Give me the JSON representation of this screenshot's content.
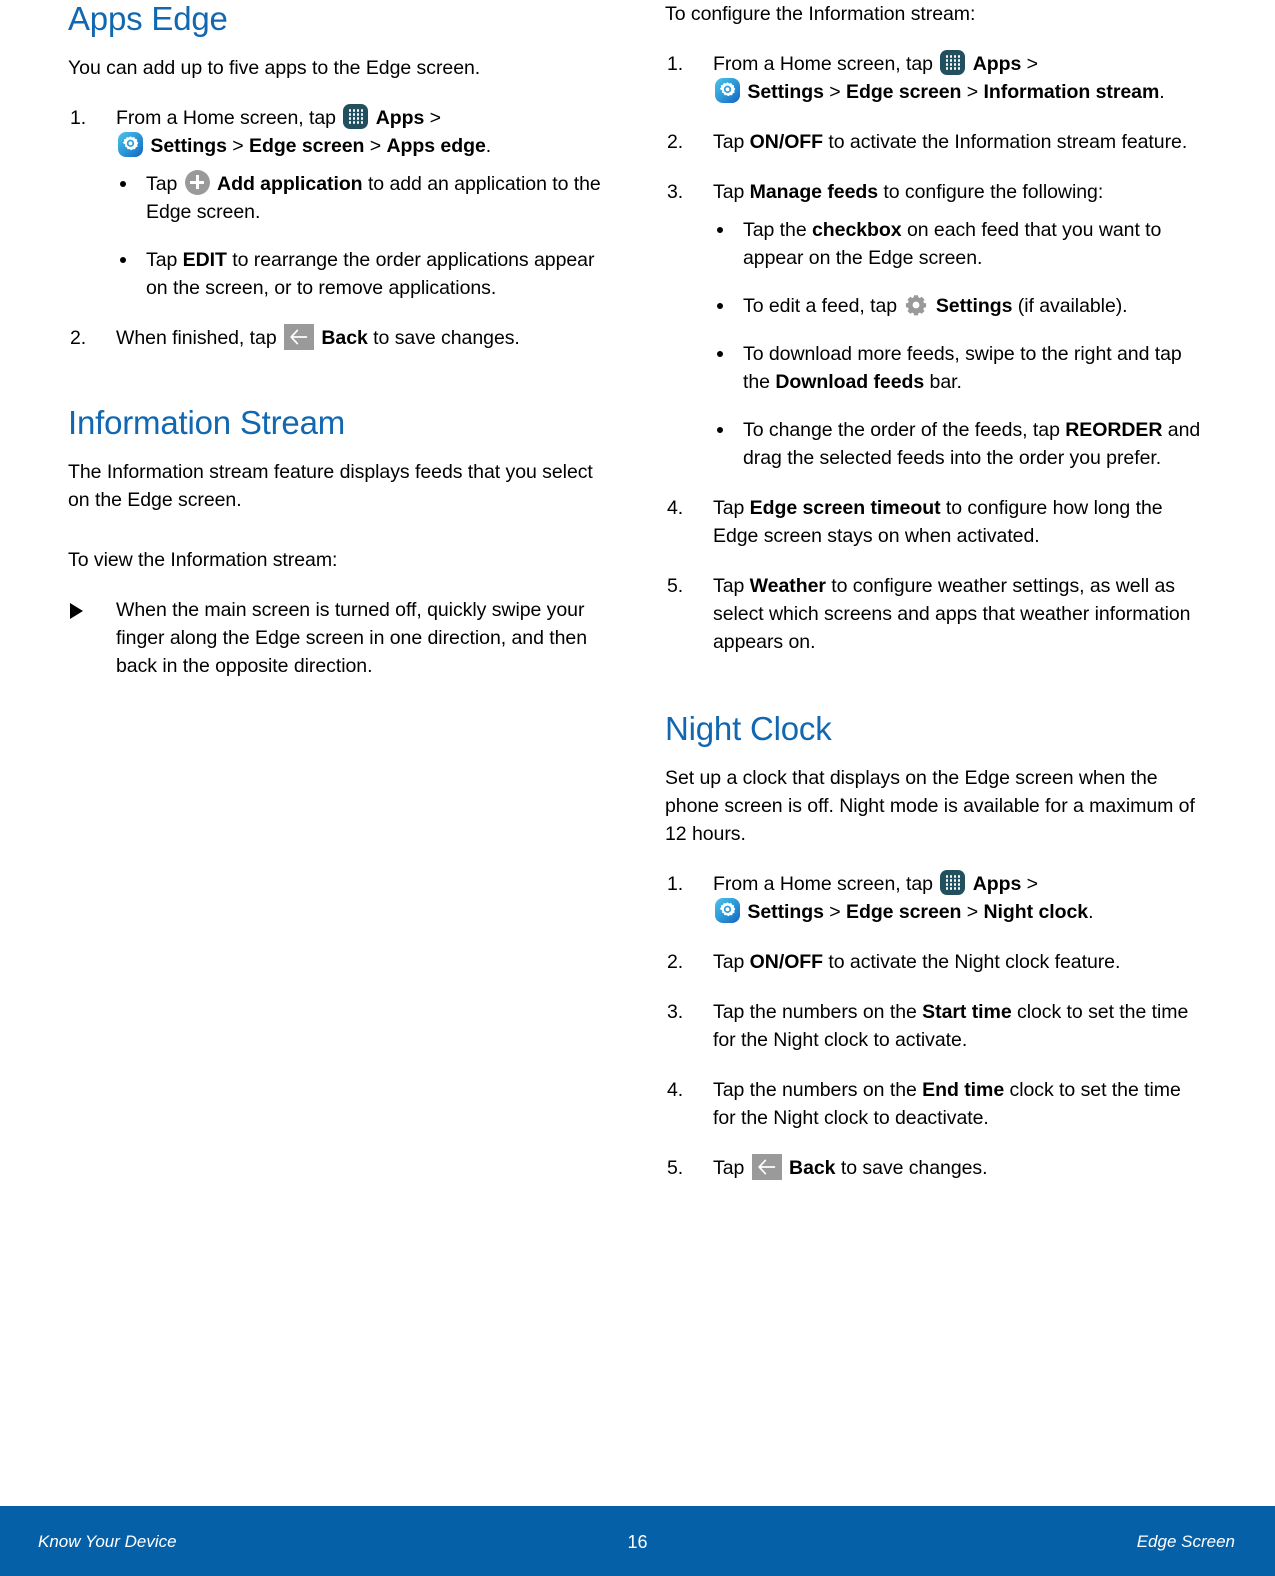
{
  "document": {
    "colors": {
      "heading_blue": "#1267b1",
      "footer_blue": "#0560a8",
      "icon_apps_bg": "#23505e",
      "icon_gray": "#9a9a9a"
    }
  },
  "left_column": {
    "heading_apps_edge": "Apps Edge",
    "intro": "You can add up to five apps to the Edge screen.",
    "step1": {
      "num": "1.",
      "t1": "From a Home screen, tap",
      "apps_label": "Apps",
      "gt1": ">",
      "settings_label": "Settings",
      "gt2": ">",
      "edge_screen_label": "Edge screen",
      "gt3": ">",
      "apps_edge_label": "Apps edge",
      "period": "."
    },
    "bullets": [
      {
        "t1": "Tap",
        "bold1": "Add application",
        "t2": "to add an application to the Edge screen."
      },
      {
        "t1": "Tap",
        "bold1": "EDIT",
        "t2": "to rearrange the order applications appear on the screen, or to remove applications."
      }
    ],
    "step2": {
      "num": "2.",
      "t1": "When finished, tap",
      "back_label": "Back",
      "t2": "to save changes."
    },
    "heading_information_stream": "Information Stream",
    "info_intro": "The Information stream feature displays feeds that you select on the Edge screen.",
    "info_view_lead": "To view the Information stream:",
    "info_view_item": "When the main screen is turned off, quickly swipe your finger along the Edge screen in one direction, and then back in the opposite direction."
  },
  "right_column": {
    "config_lead": "To configure the Information stream:",
    "step1": {
      "num": "1.",
      "t1": "From a Home screen, tap",
      "apps_label": "Apps",
      "gt1": ">",
      "settings_label": "Settings",
      "gt2": ">",
      "edge_screen_label": "Edge screen",
      "gt3": ">",
      "information_stream_label": "Information stream",
      "period": "."
    },
    "step2": {
      "num": "2.",
      "t1": "Tap",
      "bold1": "ON/OFF",
      "t2": "to activate the Information stream feature."
    },
    "step3": {
      "num": "3.",
      "t1": "Tap",
      "bold1": "Manage feeds",
      "t2": "to configure the following:"
    },
    "step3_bullets": [
      {
        "t1": "Tap the",
        "bold1": "checkbox",
        "t2": "on each feed that you want to appear on the Edge screen."
      },
      {
        "t1": "To edit a feed, tap",
        "bold1": "Settings",
        "t2": "(if available)."
      },
      {
        "t1": "To download more feeds, swipe to the right and tap the",
        "bold1": "Download feeds",
        "t2": "bar."
      },
      {
        "t1": "To change the order of the feeds, tap",
        "bold1": "REORDER",
        "t2": "and drag the selected feeds into the order you prefer."
      }
    ],
    "step4": {
      "num": "4.",
      "t1": "Tap",
      "bold1": "Edge screen timeout",
      "t2": "to configure how long the Edge screen stays on when activated."
    },
    "step5": {
      "num": "5.",
      "t1": "Tap",
      "bold1": "Weather",
      "t2": "to configure weather settings, as well as select which screens and apps that weather information appears on."
    },
    "heading_night_clock": "Night Clock",
    "night_intro": "Set up a clock that displays on the Edge screen when the phone screen is off. Night mode is available for a maximum of 12 hours.",
    "nc_step1": {
      "num": "1.",
      "t1": "From a Home screen, tap",
      "apps_label": "Apps",
      "gt1": ">",
      "settings_label": "Settings",
      "gt2": ">",
      "edge_screen_label": "Edge screen",
      "gt3": ">",
      "night_clock_label": "Night clock",
      "period": "."
    },
    "nc_step2": {
      "num": "2.",
      "t1": "Tap",
      "bold1": "ON/OFF",
      "t2": "to activate the Night clock feature."
    },
    "nc_step3": {
      "num": "3.",
      "t1": "Tap the numbers on the",
      "bold1": "Start time",
      "t2": "clock to set the time for the Night clock to activate."
    },
    "nc_step4": {
      "num": "4.",
      "t1": "Tap the numbers on the",
      "bold1": "End time",
      "t2": "clock to set the time for the Night clock to deactivate."
    },
    "nc_step5": {
      "num": "5.",
      "t1": "Tap",
      "back_label": "Back",
      "t2": "to save changes."
    }
  },
  "footer": {
    "left": "Know Your Device",
    "page_number": "16",
    "right": "Edge Screen"
  }
}
